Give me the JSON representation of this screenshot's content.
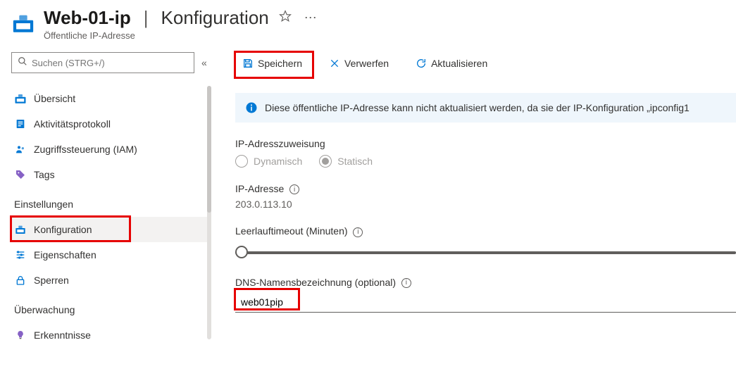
{
  "header": {
    "resource_name": "Web-01-ip",
    "separator": "|",
    "page_title": "Konfiguration",
    "resource_type": "Öffentliche IP-Adresse"
  },
  "search": {
    "placeholder": "Suchen (STRG+/)"
  },
  "sidebar": {
    "items": [
      {
        "label": "Übersicht"
      },
      {
        "label": "Aktivitätsprotokoll"
      },
      {
        "label": "Zugriffssteuerung (IAM)"
      },
      {
        "label": "Tags"
      }
    ],
    "group_settings": "Einstellungen",
    "settings_items": [
      {
        "label": "Konfiguration"
      },
      {
        "label": "Eigenschaften"
      },
      {
        "label": "Sperren"
      }
    ],
    "group_monitoring": "Überwachung",
    "monitoring_items": [
      {
        "label": "Erkenntnisse"
      }
    ]
  },
  "toolbar": {
    "save_label": "Speichern",
    "discard_label": "Verwerfen",
    "refresh_label": "Aktualisieren"
  },
  "info_message": "Diese öffentliche IP-Adresse kann nicht aktualisiert werden, da sie der IP-Konfiguration „ipconfig1",
  "form": {
    "assignment_label": "IP-Adresszuweisung",
    "radio_dynamic": "Dynamisch",
    "radio_static": "Statisch",
    "ip_address_label": "IP-Adresse",
    "ip_address_value": "203.0.113.10",
    "idle_timeout_label": "Leerlauftimeout (Minuten)",
    "dns_label": "DNS-Namensbezeichnung (optional)",
    "dns_value": "web01pip"
  }
}
